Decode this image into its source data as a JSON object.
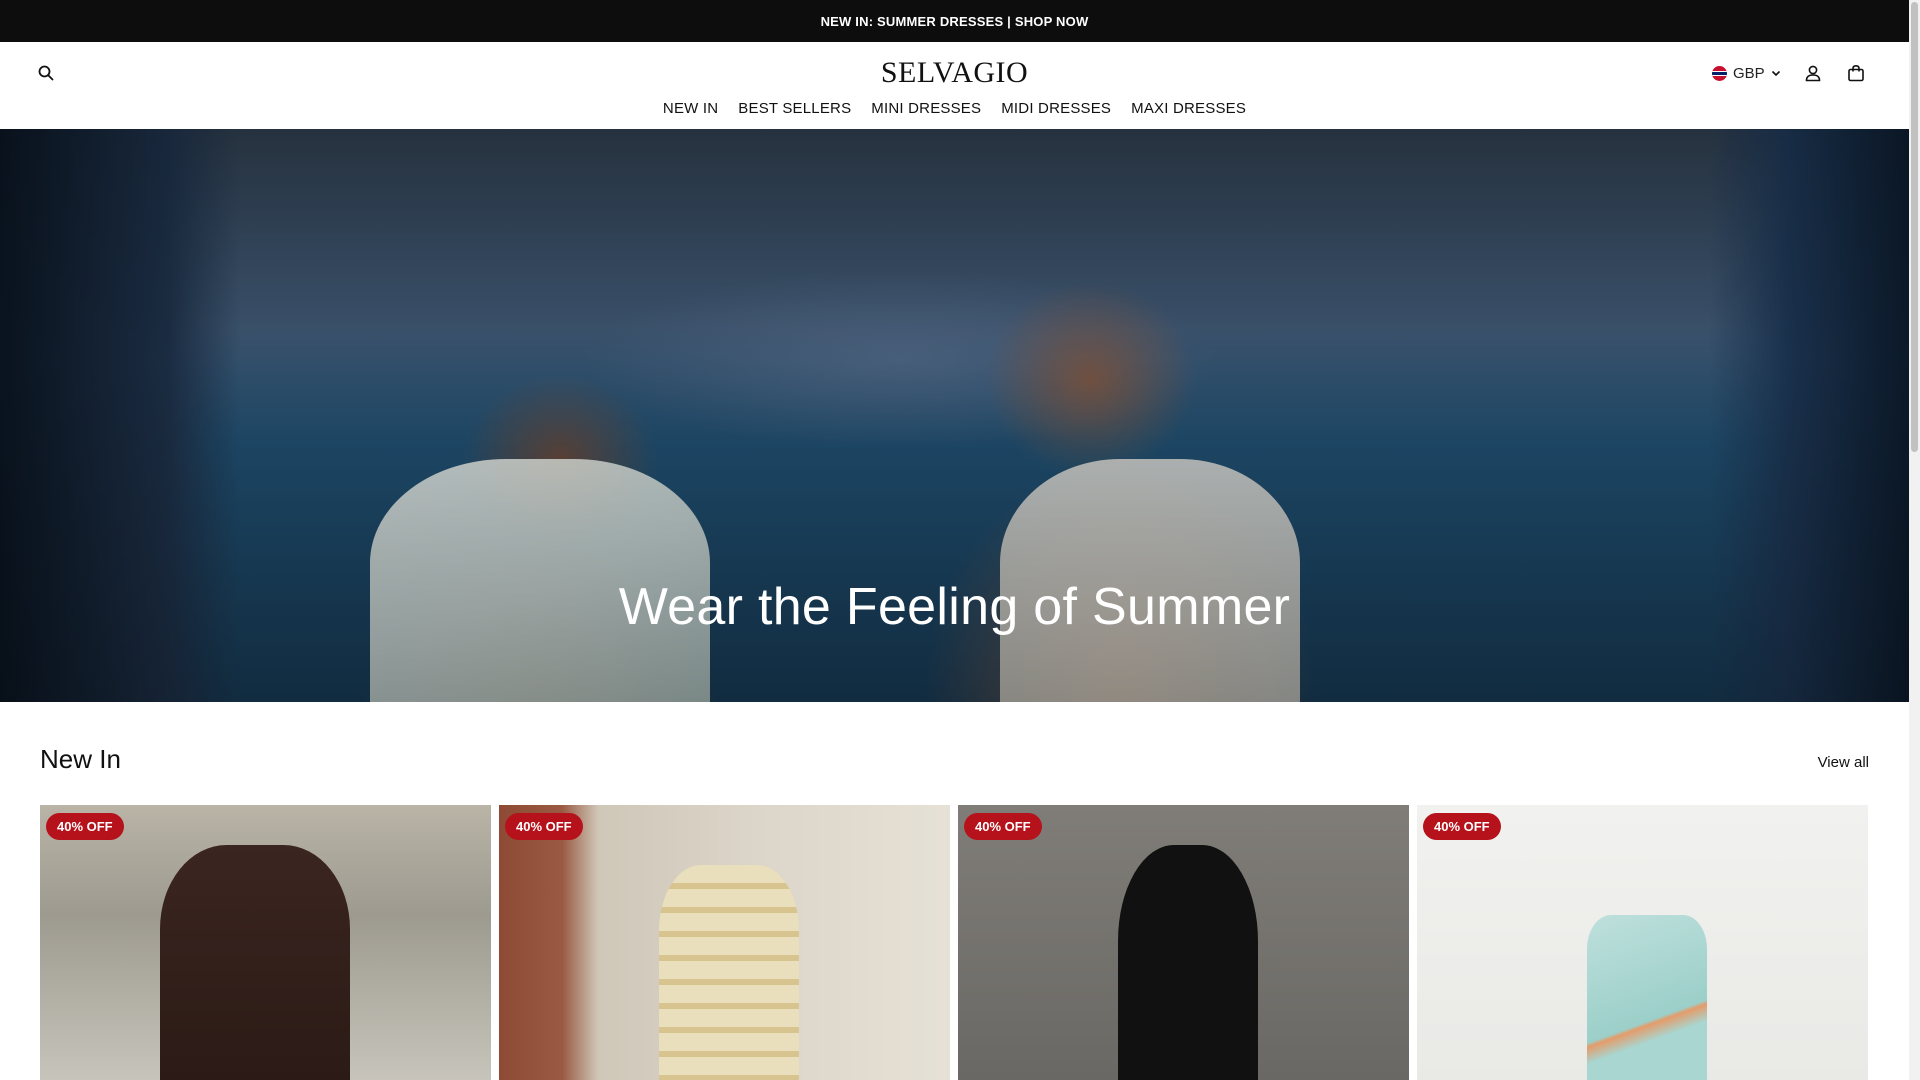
{
  "announcement": "NEW IN: SUMMER DRESSES | SHOP NOW",
  "header": {
    "logo": "SELVAGIO",
    "currency": "GBP",
    "icons": {
      "search": "search-icon",
      "account": "user-icon",
      "bag": "shopping-bag-icon",
      "currency_flag": "uk-flag-icon",
      "currency_caret": "chevron-down-icon"
    }
  },
  "nav": {
    "items": [
      "NEW IN",
      "BEST SELLERS",
      "MINI DRESSES",
      "MIDI DRESSES",
      "MAXI DRESSES"
    ]
  },
  "hero": {
    "title": "Wear the Feeling of Summer"
  },
  "new_in": {
    "title": "New In",
    "view_all": "View all",
    "products": [
      {
        "badge": "40% OFF"
      },
      {
        "badge": "40% OFF"
      },
      {
        "badge": "40% OFF"
      },
      {
        "badge": "40% OFF"
      }
    ]
  },
  "colors": {
    "announcement_bg": "#0d0d0d",
    "badge_bg": "#b5121b",
    "text": "#111111"
  }
}
